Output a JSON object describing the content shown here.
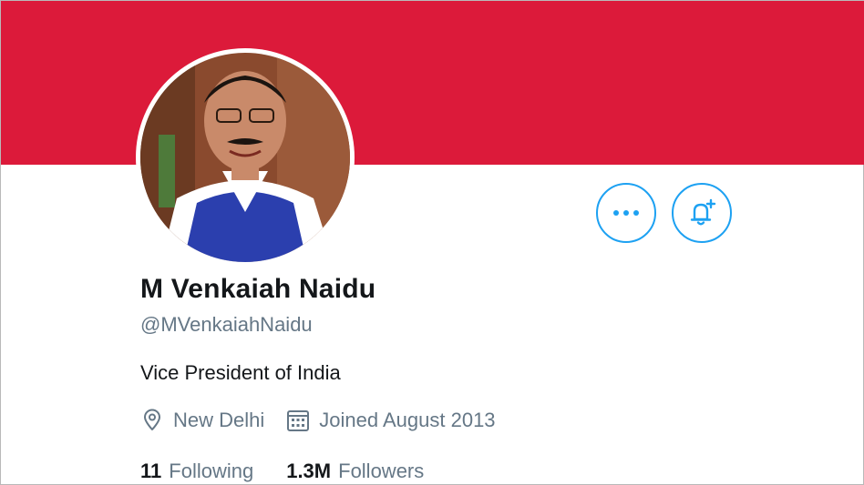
{
  "banner": {
    "color": "#dc1a3a"
  },
  "profile": {
    "name": "M Venkaiah Naidu",
    "handle": "@MVenkaiahNaidu",
    "bio": "Vice President of India",
    "location": "New Delhi",
    "joined": "Joined August 2013",
    "following_count": "11",
    "following_label": "Following",
    "followers_count": "1.3M",
    "followers_label": "Followers"
  },
  "actions": {
    "more_icon": "more-horizontal-icon",
    "notify_icon": "bell-plus-icon"
  },
  "icons": {
    "location": "location-pin-icon",
    "calendar": "calendar-icon"
  },
  "colors": {
    "accent": "#1da1f2",
    "primary_text": "#14171a",
    "secondary_text": "#657786"
  }
}
